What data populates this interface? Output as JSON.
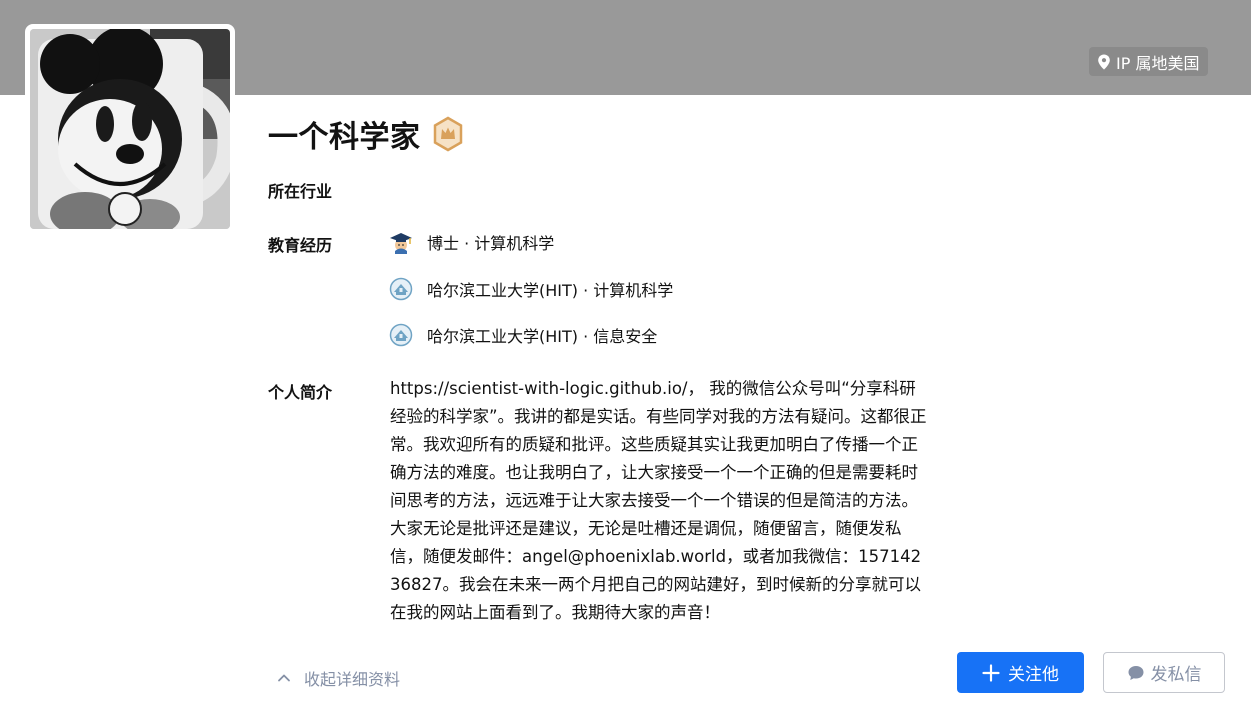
{
  "header": {
    "ip_location": "IP 属地美国"
  },
  "profile": {
    "name": "一个科学家",
    "badge_icon": "crown-badge-icon"
  },
  "details": {
    "industry_label": "所在行业",
    "education_label": "教育经历",
    "education": [
      {
        "icon": "graduation-cap-icon",
        "text": "博士 · 计算机科学"
      },
      {
        "icon": "university-logo-icon",
        "text": "哈尔滨工业大学(HIT) · 计算机科学"
      },
      {
        "icon": "university-logo-icon",
        "text": "哈尔滨工业大学(HIT) · 信息安全"
      }
    ],
    "bio_label": "个人简介",
    "bio": "https://scientist-with-logic.github.io/， 我的微信公众号叫“分享科研经验的科学家”。我讲的都是实话。有些同学对我的方法有疑问。这都很正常。我欢迎所有的质疑和批评。这些质疑其实让我更加明白了传播一个正确方法的难度。也让我明白了，让大家接受一个一个正确的但是需要耗时间思考的方法，远远难于让大家去接受一个一个错误的但是简洁的方法。大家无论是批评还是建议，无论是吐槽还是调侃，随便留言，随便发私信，随便发邮件：angel@phoenixlab.world，或者加我微信：15714236827。我会在未来一两个月把自己的网站建好，到时候新的分享就可以在我的网站上面看到了。我期待大家的声音！"
  },
  "actions": {
    "collapse_label": "收起详细资料",
    "follow_label": "关注他",
    "message_label": "发私信"
  },
  "colors": {
    "banner": "#999999",
    "primary": "#1772f6",
    "muted": "#8590a6",
    "badge_gold": "#d9a15b"
  }
}
